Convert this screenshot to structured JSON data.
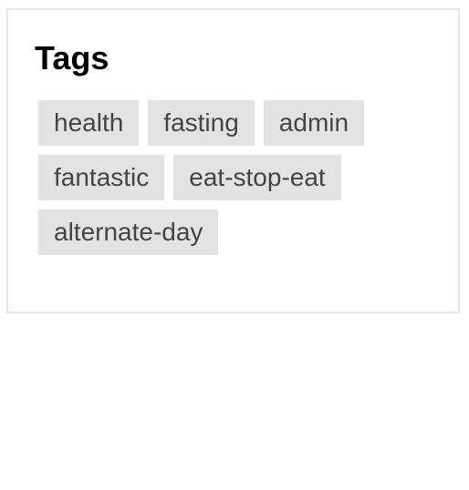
{
  "widget": {
    "title": "Tags",
    "tags": [
      {
        "label": "health"
      },
      {
        "label": "fasting"
      },
      {
        "label": "admin"
      },
      {
        "label": "fantastic"
      },
      {
        "label": "eat-stop-eat"
      },
      {
        "label": "alternate-day"
      }
    ]
  },
  "colors": {
    "tag_background": "#e3e3e3",
    "tag_text": "#444444",
    "widget_border": "#e6e6e6",
    "title_text": "#000000"
  }
}
